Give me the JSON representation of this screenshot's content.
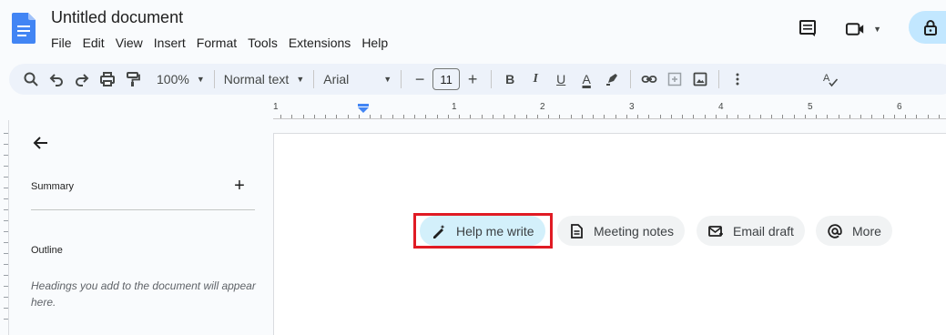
{
  "app": {
    "title": "Untitled document"
  },
  "menu": [
    "File",
    "Edit",
    "View",
    "Insert",
    "Format",
    "Tools",
    "Extensions",
    "Help"
  ],
  "toolbar": {
    "zoom": "100%",
    "style": "Normal text",
    "font": "Arial",
    "font_size": "11",
    "bold": "B",
    "italic": "I",
    "underline": "U",
    "text_color": "A"
  },
  "ruler": {
    "numbers": [
      "1",
      "1",
      "2",
      "3",
      "4",
      "5",
      "6"
    ]
  },
  "outline_panel": {
    "summary_label": "Summary",
    "add_symbol": "+",
    "outline_label": "Outline",
    "hint": "Headings you add to the document will appear here."
  },
  "chips": {
    "help_me_write": "Help me write",
    "meeting_notes": "Meeting notes",
    "email_draft": "Email draft",
    "more": "More"
  },
  "colors": {
    "accent": "#c2e7ff",
    "toolbar_bg": "#edf2fa",
    "highlight_border": "#e01b24",
    "docs_blue": "#4285f4"
  }
}
